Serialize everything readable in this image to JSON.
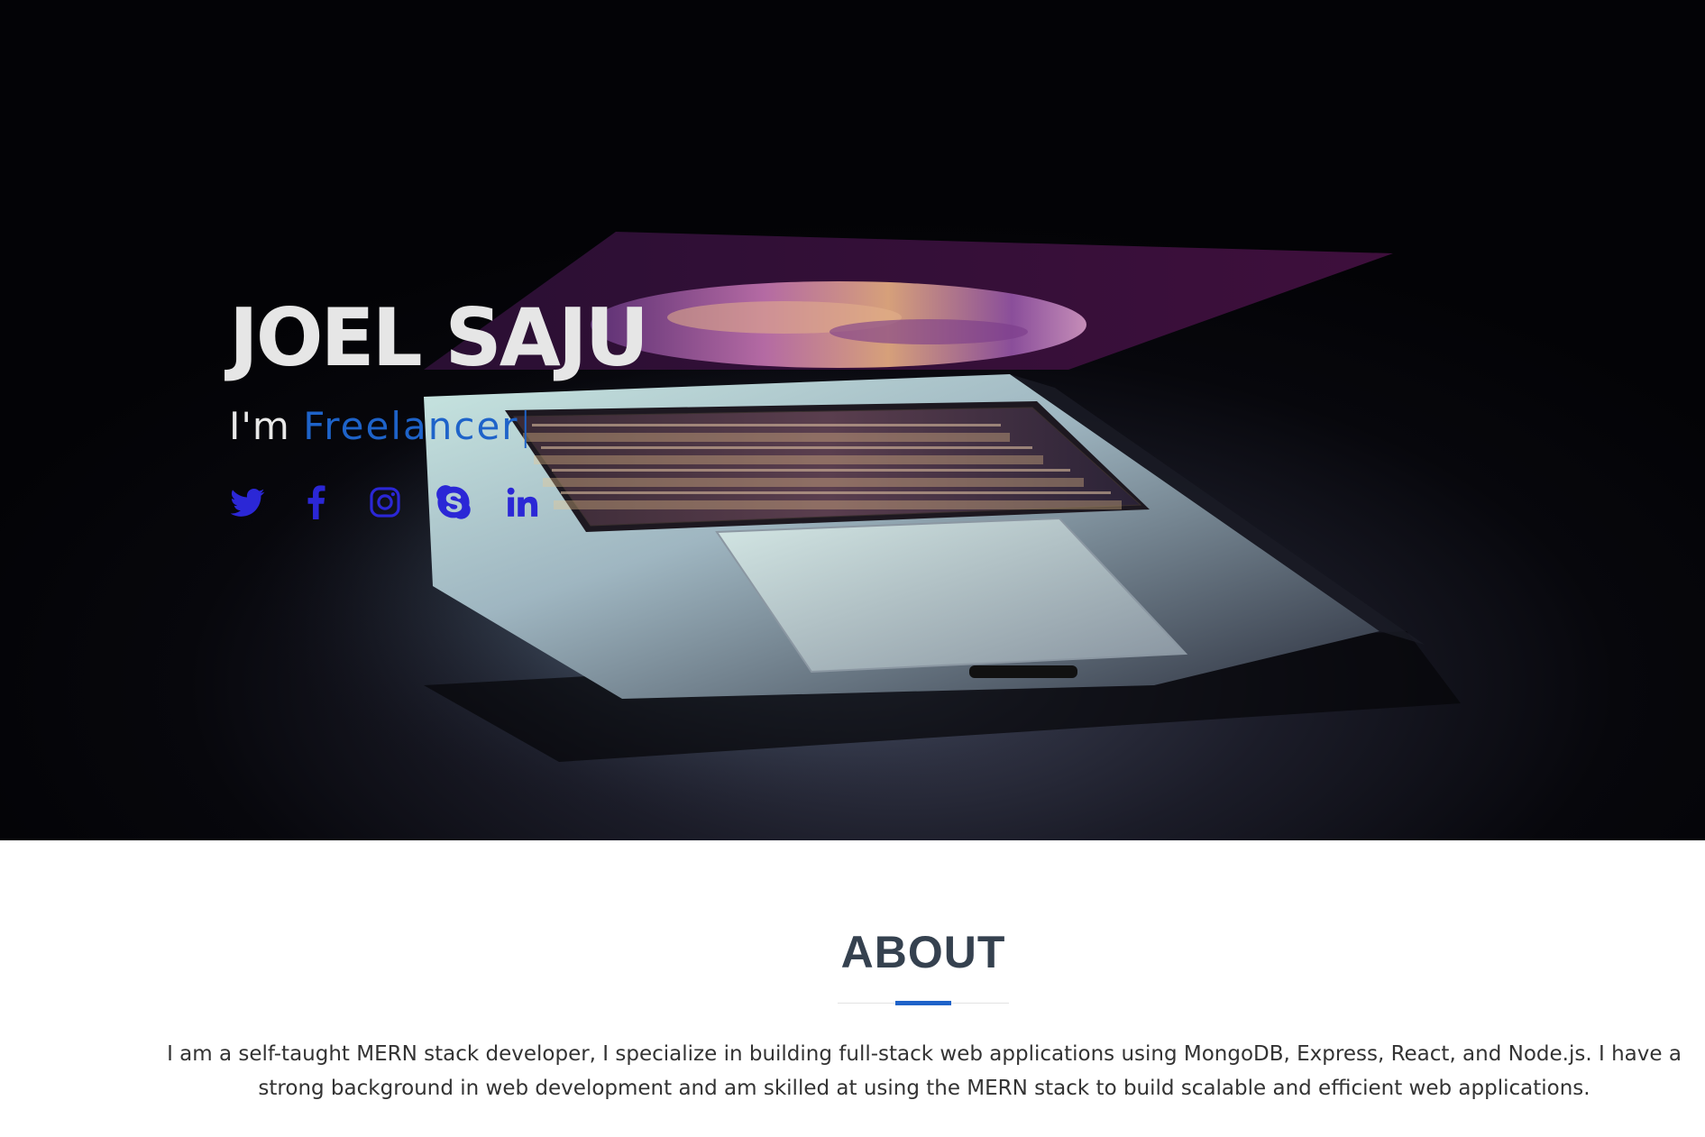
{
  "hero": {
    "name": "JOEL SAJU",
    "role_prefix": "I'm ",
    "role_typed": "Freelancer",
    "cursor": "|",
    "social": [
      {
        "name": "twitter-icon"
      },
      {
        "name": "facebook-icon"
      },
      {
        "name": "instagram-icon"
      },
      {
        "name": "skype-icon"
      },
      {
        "name": "linkedin-icon"
      }
    ],
    "icon_color": "#2b27d6",
    "accent_color": "#1e63c9"
  },
  "about": {
    "title": "ABOUT",
    "text": "I am a self-taught MERN stack developer, I specialize in building full-stack web applications using MongoDB, Express, React, and Node.js. I have a strong background in web development and am skilled at using the MERN stack to build scalable and efficient web applications."
  }
}
